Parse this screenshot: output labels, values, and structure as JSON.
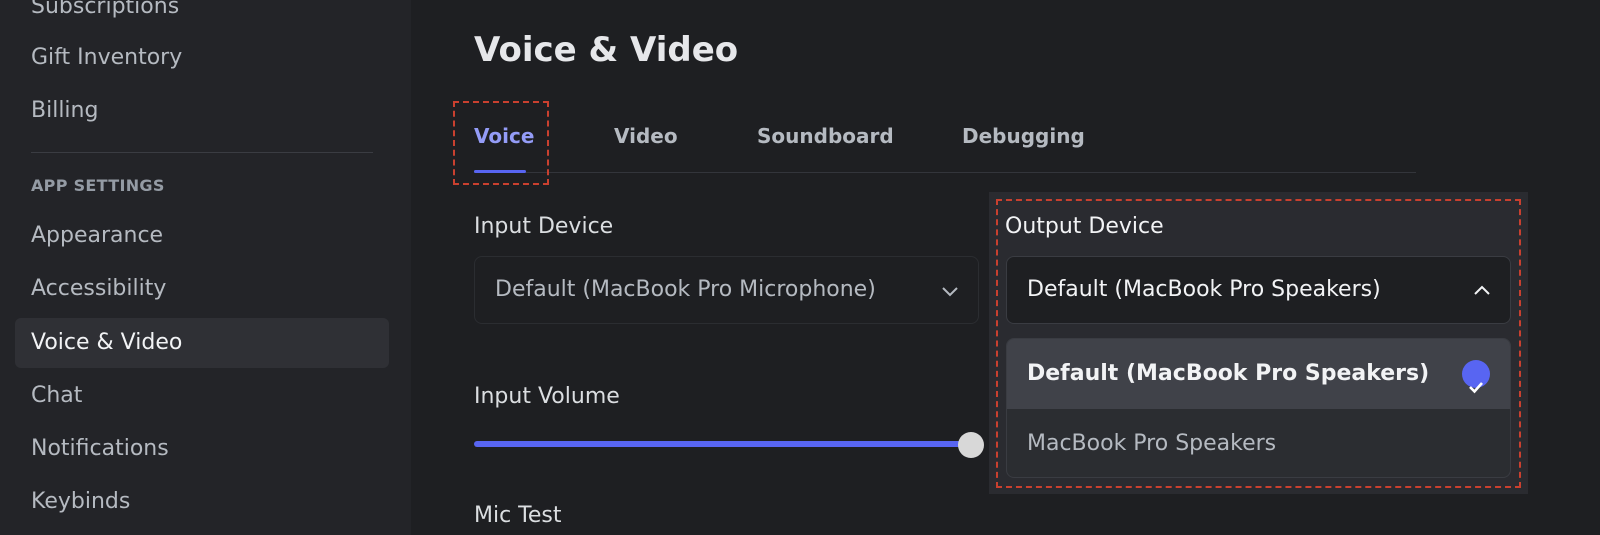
{
  "sidebar": {
    "items": [
      {
        "label": "Subscriptions"
      },
      {
        "label": "Gift Inventory"
      },
      {
        "label": "Billing"
      },
      {
        "label": "Appearance"
      },
      {
        "label": "Accessibility"
      },
      {
        "label": "Voice & Video"
      },
      {
        "label": "Chat"
      },
      {
        "label": "Notifications"
      },
      {
        "label": "Keybinds"
      }
    ],
    "section_header": "APP SETTINGS"
  },
  "page": {
    "title": "Voice & Video"
  },
  "tabs": [
    {
      "label": "Voice"
    },
    {
      "label": "Video"
    },
    {
      "label": "Soundboard"
    },
    {
      "label": "Debugging"
    }
  ],
  "input_device": {
    "label": "Input Device",
    "value": "Default (MacBook Pro Microphone)"
  },
  "output_device": {
    "label": "Output Device",
    "value": "Default (MacBook Pro Speakers)",
    "options": [
      {
        "label": "Default (MacBook Pro Speakers)"
      },
      {
        "label": "MacBook Pro Speakers"
      }
    ]
  },
  "input_volume": {
    "label": "Input Volume",
    "level": 0.98
  },
  "mic_test": {
    "label": "Mic Test"
  },
  "colors": {
    "accent": "#5865f2",
    "highlight": "#c9402f"
  }
}
